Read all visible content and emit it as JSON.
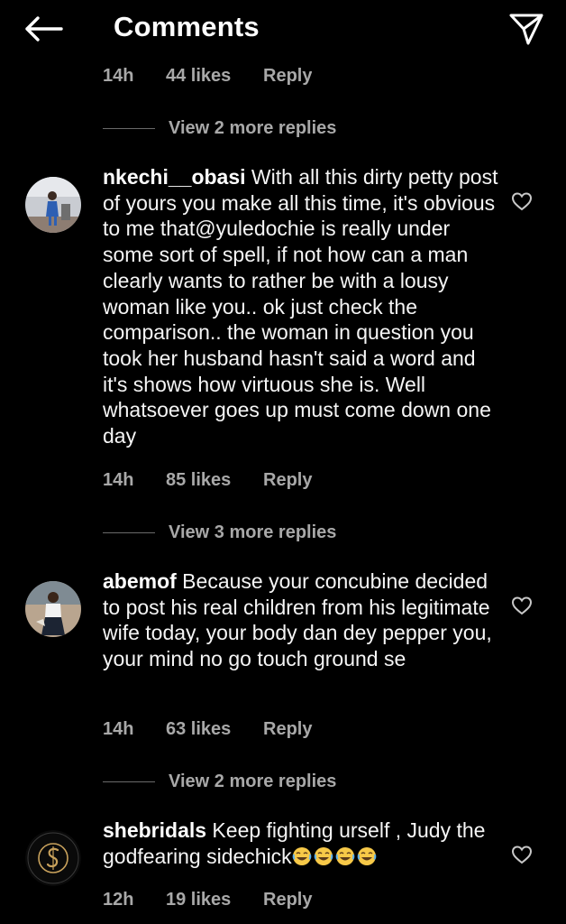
{
  "header": {
    "title": "Comments"
  },
  "partial_meta": {
    "time": "14h",
    "likes": "44 likes",
    "reply": "Reply"
  },
  "view_more_1": "View 2 more replies",
  "comments": [
    {
      "username": "nkechi__obasi",
      "text": " With all this dirty petty post of yours you make all this time, it's obvious to me that@yuledochie is really under some sort of spell, if not how can a man clearly wants to rather be with a lousy woman like you.. ok just check the comparison.. the woman in question you took her husband hasn't said a word and it's shows how virtuous she is. Well whatsoever goes up must come down one day",
      "time": "14h",
      "likes": "85 likes",
      "reply": "Reply",
      "view_more": "View 3 more replies"
    },
    {
      "username": "abemof",
      "text": " Because your concubine decided to post his real children from his legitimate wife today, your body dan dey pepper you, your mind no go touch ground se",
      "time": "14h",
      "likes": "63 likes",
      "reply": "Reply",
      "view_more": "View 2 more replies"
    },
    {
      "username": "shebridals",
      "text": " Keep fighting urself , Judy the godfearing sidechick",
      "emoji": "😂😂😂😂",
      "time": "12h",
      "likes": "19 likes",
      "reply": "Reply"
    }
  ],
  "icons": {
    "back": "back-arrow-icon",
    "send": "send-icon",
    "like": "heart-icon",
    "emoji": "laughing-tears-emoji"
  },
  "colors": {
    "background": "#000000",
    "text": "#f5f5f5",
    "secondary": "#a8a8a8"
  }
}
